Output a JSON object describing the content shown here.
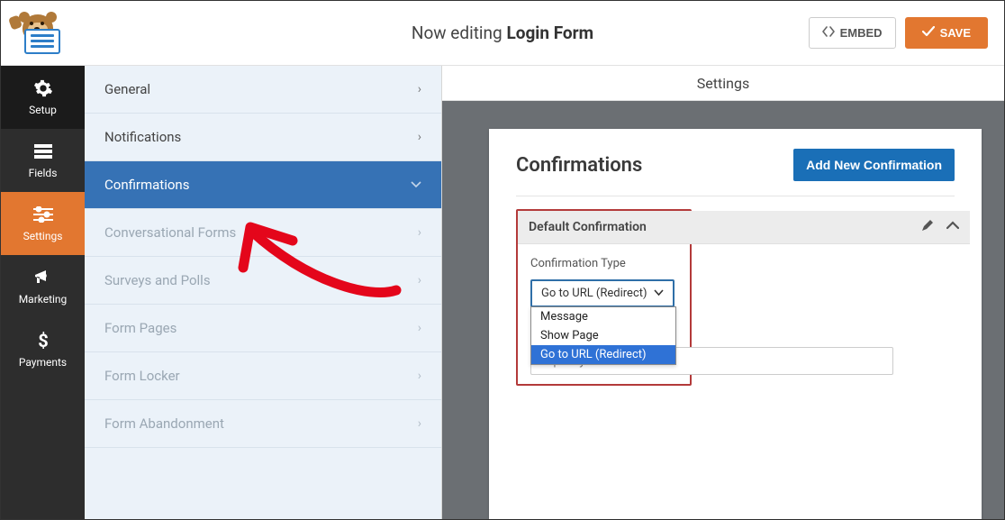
{
  "header": {
    "now_editing_prefix": "Now editing ",
    "form_name": "Login Form",
    "embed_label": "EMBED",
    "save_label": "SAVE"
  },
  "left_nav": {
    "setup": "Setup",
    "fields": "Fields",
    "settings": "Settings",
    "marketing": "Marketing",
    "payments": "Payments"
  },
  "settings_section_title": "Settings",
  "settings_menu": {
    "general": "General",
    "notifications": "Notifications",
    "confirmations": "Confirmations",
    "conversational": "Conversational Forms",
    "surveys": "Surveys and Polls",
    "form_pages": "Form Pages",
    "form_locker": "Form Locker",
    "form_abandonment": "Form Abandonment"
  },
  "panel": {
    "title": "Confirmations",
    "add_new": "Add New Confirmation",
    "default_header": "Default Confirmation",
    "type_label": "Confirmation Type",
    "select_value": "Go to URL (Redirect)",
    "options": {
      "message": "Message",
      "show_page": "Show Page",
      "redirect": "Go to URL (Redirect)"
    },
    "url_value": "http://mytestsite.com"
  }
}
